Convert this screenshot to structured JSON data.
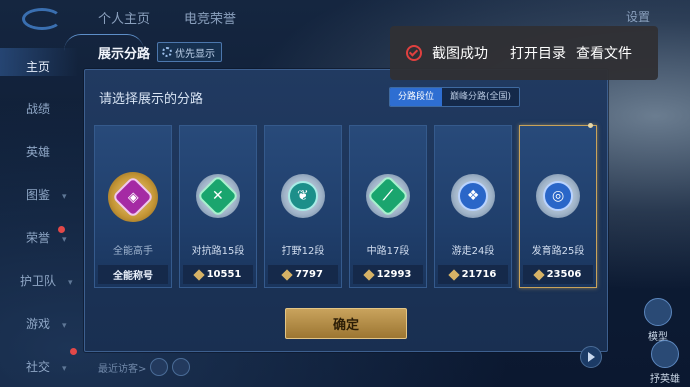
{
  "topbar": {
    "tab1": "个人主页",
    "tab2": "电竞荣誉",
    "settings": "设置"
  },
  "sidenav": {
    "items": [
      {
        "label": "主页",
        "active": true
      },
      {
        "label": "战绩",
        "active": false
      },
      {
        "label": "英雄",
        "active": false
      },
      {
        "label": "图鉴",
        "active": false
      },
      {
        "label": "荣誉",
        "active": false
      },
      {
        "label": "护卫队",
        "active": false
      },
      {
        "label": "游戏",
        "active": false
      },
      {
        "label": "社交",
        "active": false
      }
    ]
  },
  "right_side": {
    "model_label": "模型",
    "hero_label": "抒英雄"
  },
  "dialog": {
    "title": "展示分路",
    "priority_label": "优先显示",
    "subtitle": "请选择展示的分路",
    "toggle": {
      "active": "分路段位",
      "inactive": "巅峰分路(全国)"
    },
    "cards": [
      {
        "name": "全能高手",
        "score": "全能称号",
        "emblem": "gold",
        "glyph": "◈",
        "selected": false
      },
      {
        "name": "对抗路15段",
        "score": "10551",
        "emblem": "green",
        "glyph": "✕",
        "selected": false
      },
      {
        "name": "打野12段",
        "score": "7797",
        "emblem": "teal",
        "glyph": "❦",
        "selected": false
      },
      {
        "name": "中路17段",
        "score": "12993",
        "emblem": "green",
        "glyph": "⟋",
        "selected": false
      },
      {
        "name": "游走24段",
        "score": "21716",
        "emblem": "blue",
        "glyph": "❖",
        "selected": false
      },
      {
        "name": "发育路25段",
        "score": "23506",
        "emblem": "blue",
        "glyph": "◎",
        "selected": true
      }
    ],
    "confirm": "确定",
    "footer": "最近访客>"
  },
  "toast": {
    "message": "截图成功",
    "open_folder": "打开目录",
    "view_file": "查看文件"
  },
  "colors": {
    "accent_gold": "#c9a35d",
    "toggle_active": "#2e6ed2",
    "toast_bg": "#303034",
    "toast_icon": "#e0403f"
  }
}
